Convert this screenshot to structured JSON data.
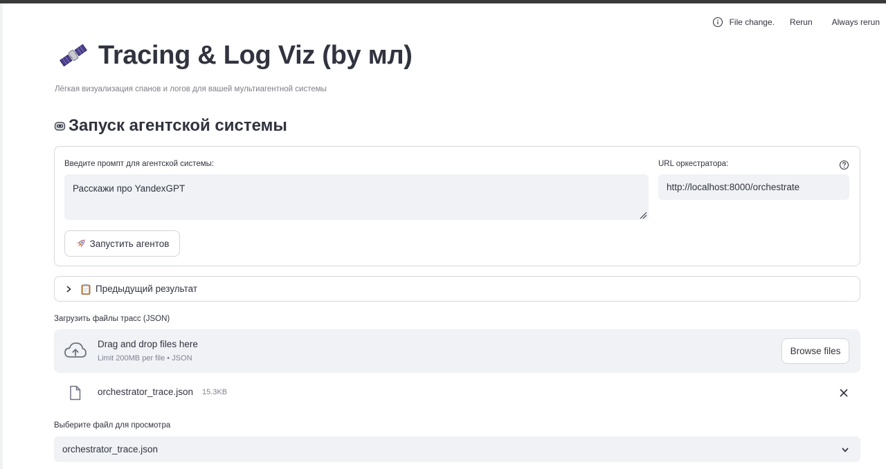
{
  "status_bar": {
    "file_change": "File change.",
    "rerun": "Rerun",
    "always_rerun": "Always rerun"
  },
  "header": {
    "title": "Tracing & Log Viz (by мл)",
    "subtitle": "Лёгкая визуализация спанов и логов для вашей мультиагентной системы",
    "icon": "satellite-icon"
  },
  "section": {
    "heading": "Запуск агентской системы",
    "icon": "robot-face-icon"
  },
  "form": {
    "prompt_label": "Введите промпт для агентской системы:",
    "prompt_value": "Расскажи про YandexGPT",
    "url_label": "URL оркестратора:",
    "url_value": "http://localhost:8000/orchestrate",
    "launch_label": "Запустить агентов"
  },
  "expander": {
    "label": "Предыдущий результат"
  },
  "uploader": {
    "label": "Загрузить файлы трасс (JSON)",
    "drop_text": "Drag and drop files here",
    "limit_text": "Limit 200MB per file • JSON",
    "browse_label": "Browse files",
    "file": {
      "name": "orchestrator_trace.json",
      "size": "15.3KB"
    }
  },
  "select": {
    "label": "Выберите файл для просмотра",
    "value": "orchestrator_trace.json"
  },
  "colors": {
    "text": "#31333f",
    "input_bg": "#f0f2f6",
    "border": "#d7d8dc",
    "muted": "#808495"
  }
}
